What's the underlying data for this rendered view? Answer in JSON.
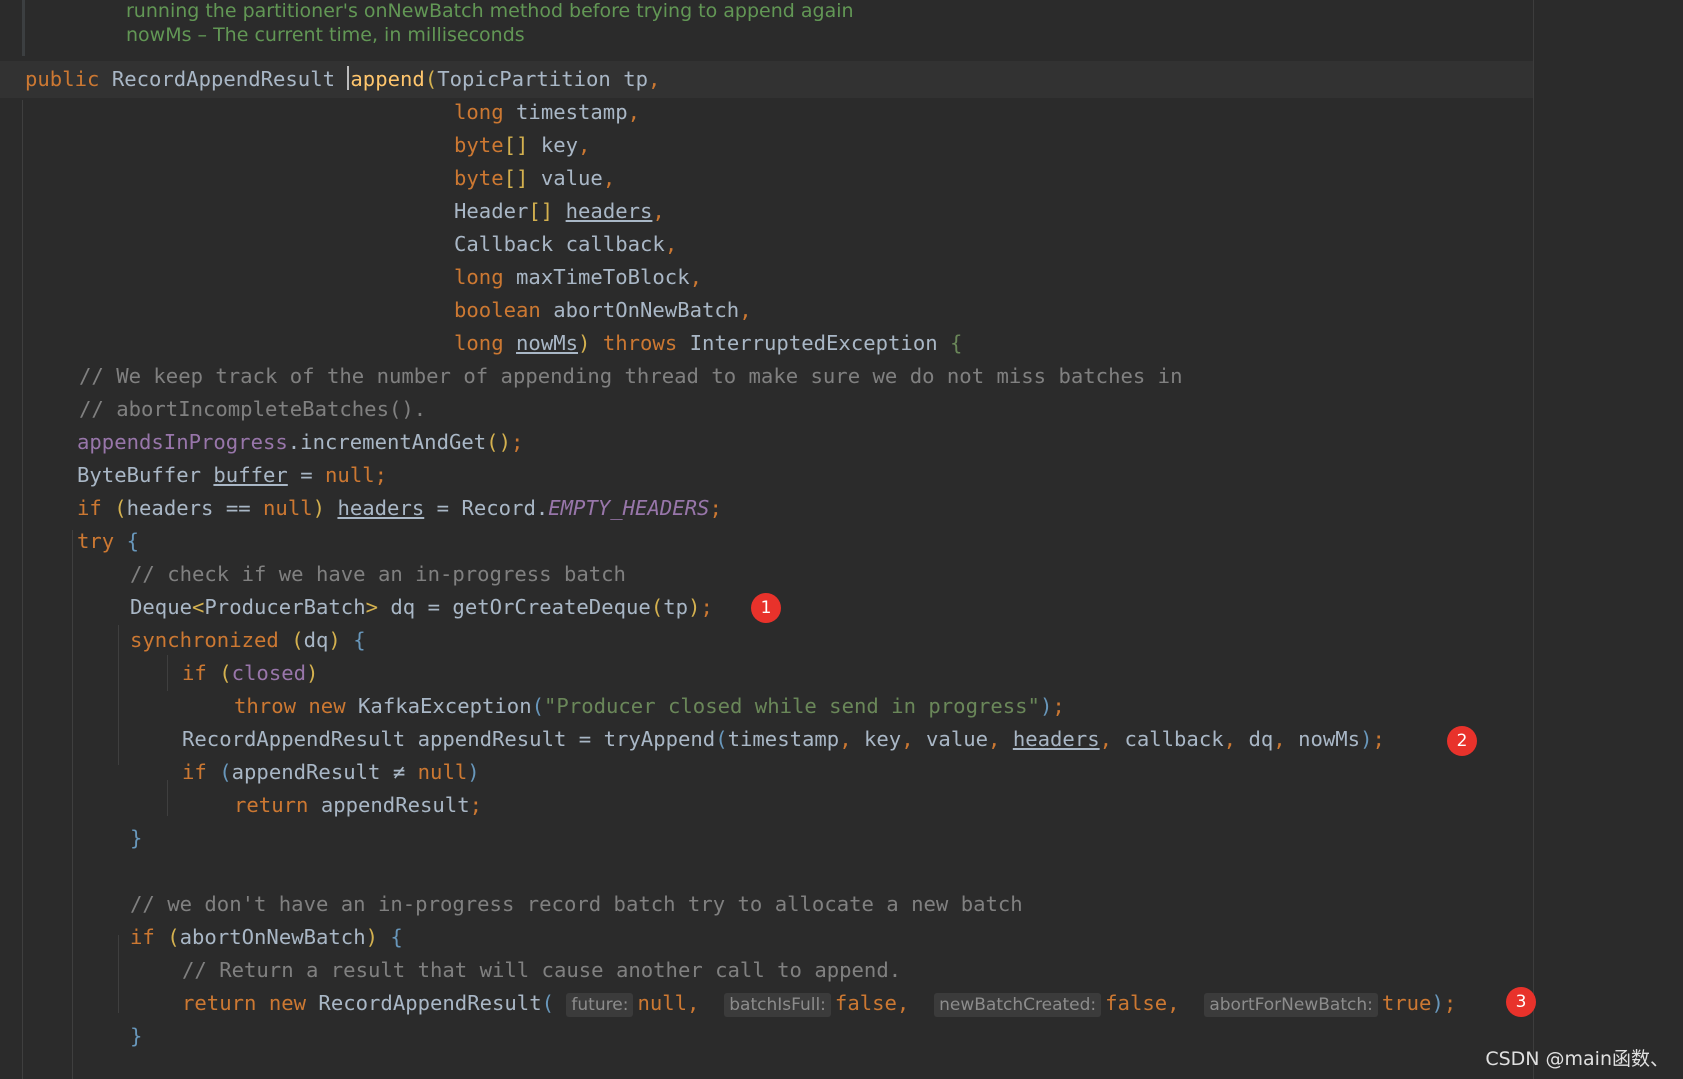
{
  "doc": {
    "line1": "running the partitioner's onNewBatch method before trying to append again",
    "line2": "nowMs – The current time, in milliseconds"
  },
  "code": {
    "l1": {
      "public": "public",
      "type": "RecordAppendResult",
      "name": "append",
      "param_type": "TopicPartition",
      "param": "tp"
    },
    "l2": {
      "type": "long",
      "name": "timestamp"
    },
    "l3": {
      "type": "byte",
      "name": "key"
    },
    "l4": {
      "type": "byte",
      "name": "value"
    },
    "l5": {
      "type": "Header",
      "name": "headers"
    },
    "l6": {
      "type": "Callback",
      "name": "callback"
    },
    "l7": {
      "type": "long",
      "name": "maxTimeToBlock"
    },
    "l8": {
      "type": "boolean",
      "name": "abortOnNewBatch"
    },
    "l9": {
      "type": "long",
      "name": "nowMs",
      "throws": "throws",
      "exception": "InterruptedException"
    },
    "c1": "// We keep track of the number of appending thread to make sure we do not miss batches in",
    "c2": "// abortIncompleteBatches().",
    "l12": {
      "field": "appendsInProgress",
      "call": ".incrementAndGet"
    },
    "l13": {
      "type": "ByteBuffer",
      "var": "buffer",
      "null": "null"
    },
    "l14": {
      "if": "if",
      "var": "headers",
      "null": "null",
      "var2": "headers",
      "rhs": "Record.",
      "const": "EMPTY_HEADERS"
    },
    "l15": {
      "try": "try"
    },
    "c3": "// check if we have an in-progress batch",
    "l17": {
      "type": "Deque",
      "generic": "ProducerBatch",
      "var": "dq",
      "call": "getOrCreateDeque",
      "arg": "tp"
    },
    "l18": {
      "kw": "synchronized",
      "var": "dq"
    },
    "l19": {
      "if": "if",
      "field": "closed"
    },
    "l20": {
      "throw": "throw",
      "new": "new",
      "type": "KafkaException",
      "msg": "\"Producer closed while send in progress\""
    },
    "l21": {
      "type": "RecordAppendResult",
      "var": "appendResult",
      "call": "tryAppend",
      "args": [
        "timestamp",
        "key",
        "value",
        "headers",
        "callback",
        "dq",
        "nowMs"
      ]
    },
    "l22": {
      "if": "if",
      "var": "appendResult",
      "op": "≠",
      "null": "null"
    },
    "l23": {
      "return": "return",
      "var": "appendResult"
    },
    "c4": "// we don't have an in-progress record batch try to allocate a new batch",
    "l26": {
      "if": "if",
      "var": "abortOnNewBatch"
    },
    "c5": "// Return a result that will cause another call to append.",
    "l28": {
      "return": "return",
      "new": "new",
      "type": "RecordAppendResult",
      "hints": [
        {
          "label": "future:",
          "value": "null"
        },
        {
          "label": "batchIsFull:",
          "value": "false"
        },
        {
          "label": "newBatchCreated:",
          "value": "false"
        },
        {
          "label": "abortForNewBatch:",
          "value": "true"
        }
      ]
    }
  },
  "badges": [
    "1",
    "2",
    "3"
  ],
  "watermark": "CSDN @main函数、",
  "colors": {
    "background": "#2b2b2b",
    "keyword": "#cc7832",
    "method": "#ffc66d",
    "comment": "#808080",
    "string": "#6a8759",
    "field": "#9876aa",
    "badge": "#e8322b"
  }
}
